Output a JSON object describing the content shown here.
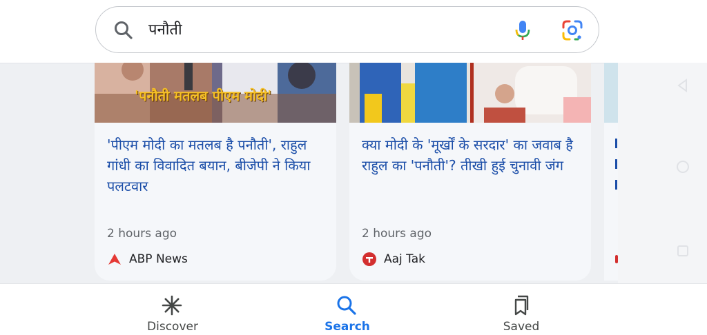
{
  "search": {
    "query": "पनौती"
  },
  "cards": [
    {
      "image_caption": "'पनौती मतलब पीएम मोदी'",
      "title": "'पीएम मोदी का मतलब है पनौती', राहुल गांधी का विवादित बयान, बीजेपी ने किया पलटवार",
      "time": "2 hours ago",
      "source": "ABP News"
    },
    {
      "title": "क्या मोदी के 'मूर्खों के सरदार' का जवाब है राहुल का 'पनौती'? तीखी हुई चुनावी जंग",
      "time": "2 hours ago",
      "source": "Aaj Tak"
    }
  ],
  "bottom_nav": [
    {
      "label": "Discover",
      "icon": "asterisk-icon",
      "active": false
    },
    {
      "label": "Search",
      "icon": "search-icon",
      "active": true
    },
    {
      "label": "Saved",
      "icon": "bookmark-icon",
      "active": false
    }
  ],
  "colors": {
    "link": "#1a4da8",
    "active_tab": "#1a73e8",
    "abp_red": "#e53935",
    "aajtak_red": "#d32f2f"
  }
}
